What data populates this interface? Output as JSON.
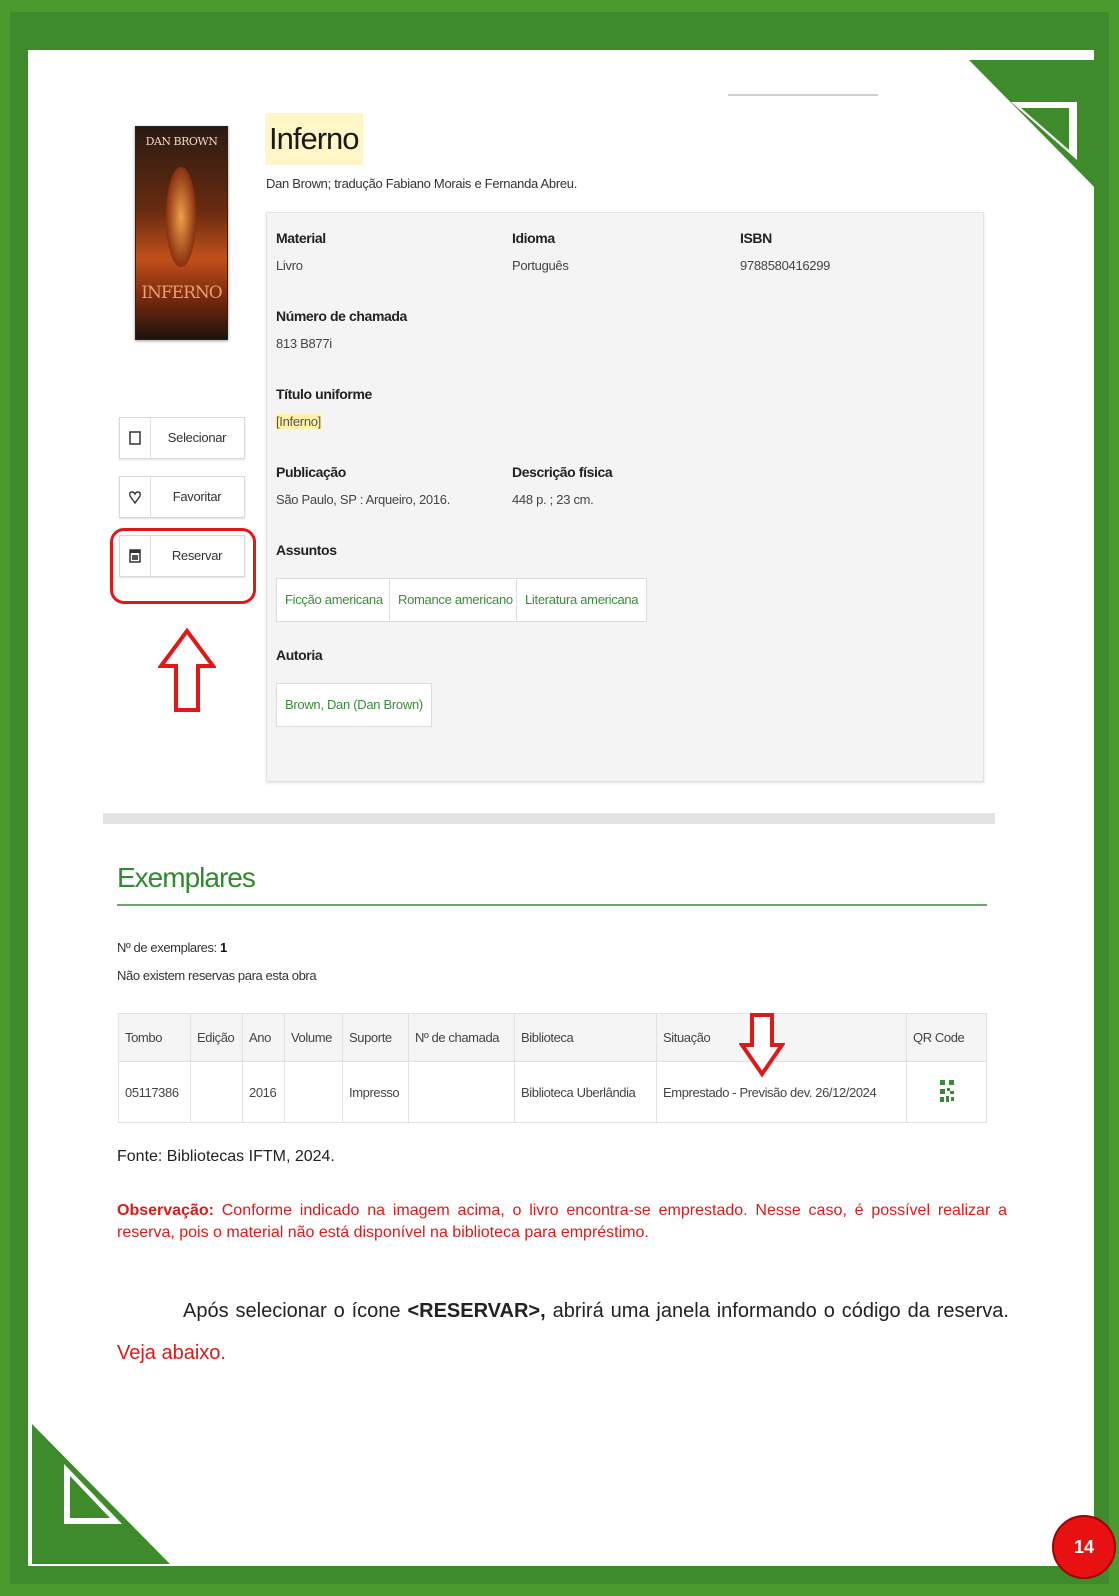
{
  "cover": {
    "author": "DAN BROWN",
    "title": "INFERNO"
  },
  "book": {
    "title": "Inferno",
    "author_line": "Dan Brown; tradução Fabiano Morais e Fernanda Abreu."
  },
  "details": {
    "material_label": "Material",
    "material_value": "Livro",
    "idioma_label": "Idioma",
    "idioma_value": "Português",
    "isbn_label": "ISBN",
    "isbn_value": "9788580416299",
    "chamada_label": "Número de chamada",
    "chamada_value": "813 B877i",
    "titulo_uniforme_label": "Título uniforme",
    "titulo_uniforme_value": "[Inferno]",
    "publicacao_label": "Publicação",
    "publicacao_value": "São Paulo, SP : Arqueiro, 2016.",
    "descricao_label": "Descrição física",
    "descricao_value": "448 p. ; 23 cm.",
    "assuntos_label": "Assuntos",
    "assuntos": [
      "Ficção americana",
      "Romance americano",
      "Literatura americana"
    ],
    "autoria_label": "Autoria",
    "autoria": [
      "Brown, Dan (Dan Brown)"
    ]
  },
  "actions": {
    "selecionar": "Selecionar",
    "favoritar": "Favoritar",
    "reservar": "Reservar"
  },
  "exemplares": {
    "title": "Exemplares",
    "count_label": "Nº de exemplares:",
    "count_value": "1",
    "reservas_text": "Não existem reservas para esta obra",
    "headers": [
      "Tombo",
      "Edição",
      "Ano",
      "Volume",
      "Suporte",
      "Nº de chamada",
      "Biblioteca",
      "Situação",
      "QR Code"
    ],
    "rows": [
      [
        "05117386",
        "",
        "2016",
        "",
        "Impresso",
        "",
        "Biblioteca Uberlândia",
        "Emprestado - Previsão dev. 26/12/2024",
        ""
      ]
    ]
  },
  "fonte": "Fonte: Bibliotecas IFTM, 2024.",
  "observacao": {
    "label": "Observação:",
    "text": "Conforme indicado na imagem acima, o livro encontra-se emprestado. Nesse caso, é possível realizar a reserva, pois o material não está disponível na biblioteca para empréstimo."
  },
  "paragraph": {
    "before": "Após selecionar o ícone ",
    "strong": "<RESERVAR>,",
    "after": " abrirá uma janela informando o código da reserva. ",
    "red": "Veja abaixo."
  },
  "page_number": "14",
  "colors": {
    "frame_green": "#3d8b2a",
    "accent_green": "#2e8b2e",
    "alert_red": "#e01818"
  }
}
